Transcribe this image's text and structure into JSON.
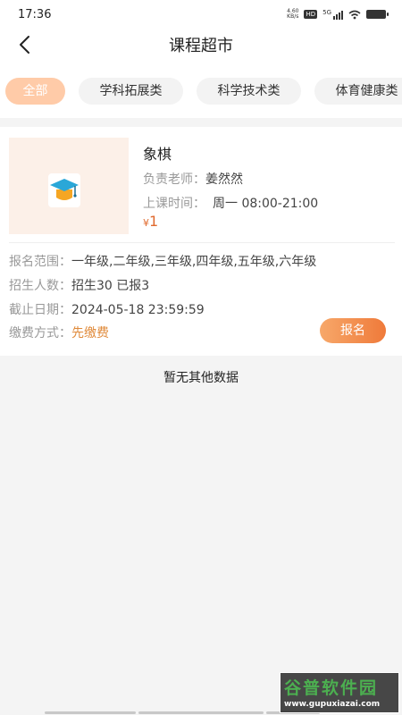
{
  "status": {
    "time": "17:36",
    "speed": "4.60",
    "speed_unit": "KB/s",
    "hd": "HD",
    "network": "5G"
  },
  "header": {
    "title": "课程超市"
  },
  "tabs": [
    {
      "label": "全部",
      "active": true
    },
    {
      "label": "学科拓展类",
      "active": false
    },
    {
      "label": "科学技术类",
      "active": false
    },
    {
      "label": "体育健康类",
      "active": false
    }
  ],
  "course": {
    "name": "象棋",
    "teacher_label": "负责老师：",
    "teacher": "姜然然",
    "time_label": "上课时间：",
    "time": "周一 08:00-21:00",
    "currency": "¥",
    "price": "1",
    "range_label": "报名范围：",
    "range": "一年级,二年级,三年级,四年级,五年级,六年级",
    "enroll_label": "招生人数：",
    "enroll": "招生30 已报3",
    "deadline_label": "截止日期：",
    "deadline": "2024-05-18 23:59:59",
    "pay_label": "缴费方式：",
    "pay": "先缴费",
    "button": "报名"
  },
  "empty_text": "暂无其他数据",
  "watermark": {
    "name": "谷普软件园",
    "url": "www.gupuxiazai.com"
  },
  "colors": {
    "accent": "#ef7a3a",
    "tab_active": "#ffcba8",
    "price": "#e06a2e"
  }
}
